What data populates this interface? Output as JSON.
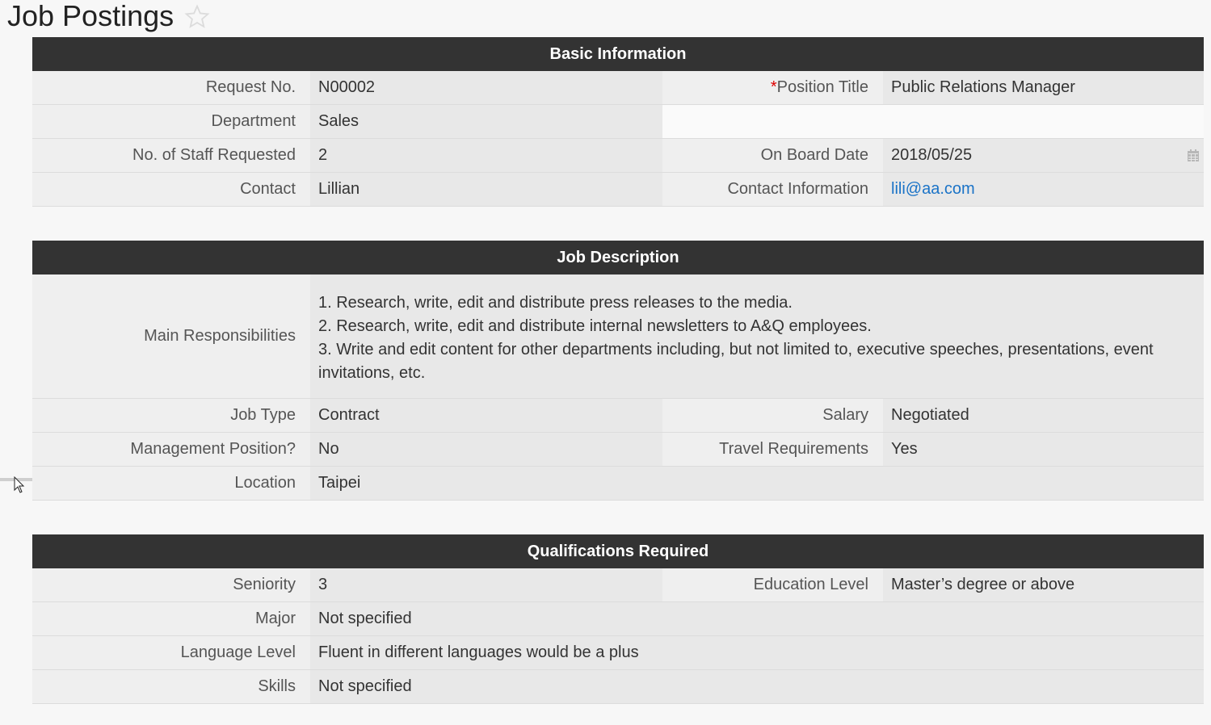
{
  "page": {
    "title": "Job Postings"
  },
  "icons": {
    "favorite": "star-icon",
    "calendar": "calendar-icon",
    "cursor": "mouse-cursor-icon"
  },
  "colors": {
    "header_bg": "#333333",
    "link": "#1a73c7",
    "required": "#dd0000"
  },
  "basic": {
    "header": "Basic Information",
    "request_no_label": "Request No.",
    "request_no": "N00002",
    "required_mark": "*",
    "position_title_label": "Position Title",
    "position_title": "Public Relations Manager",
    "department_label": "Department",
    "department": "Sales",
    "staff_label": "No. of Staff Requested",
    "staff": "2",
    "onboard_label": "On Board Date",
    "onboard": "2018/05/25",
    "contact_label": "Contact",
    "contact": "Lillian",
    "contact_info_label": "Contact Information",
    "contact_info": "lili@aa.com"
  },
  "job": {
    "header": "Job Description",
    "resp_label": "Main Responsibilities",
    "resp_lines": [
      "1. Research, write, edit and distribute press releases to the media.",
      "2. Research, write, edit and distribute internal newsletters to A&Q employees.",
      "3. Write and edit content for other departments including, but not limited to, executive speeches, presentations, event invitations, etc."
    ],
    "job_type_label": "Job Type",
    "job_type": "Contract",
    "salary_label": "Salary",
    "salary": "Negotiated",
    "mgmt_label": "Management Position?",
    "mgmt": "No",
    "travel_label": "Travel Requirements",
    "travel": "Yes",
    "location_label": "Location",
    "location": "Taipei"
  },
  "qual": {
    "header": "Qualifications Required",
    "seniority_label": "Seniority",
    "seniority": "3",
    "education_label": "Education Level",
    "education": "Master’s degree or above",
    "major_label": "Major",
    "major": "Not specified",
    "language_label": "Language Level",
    "language": "Fluent in different languages would be a plus",
    "skills_label": "Skills",
    "skills": "Not specified"
  }
}
